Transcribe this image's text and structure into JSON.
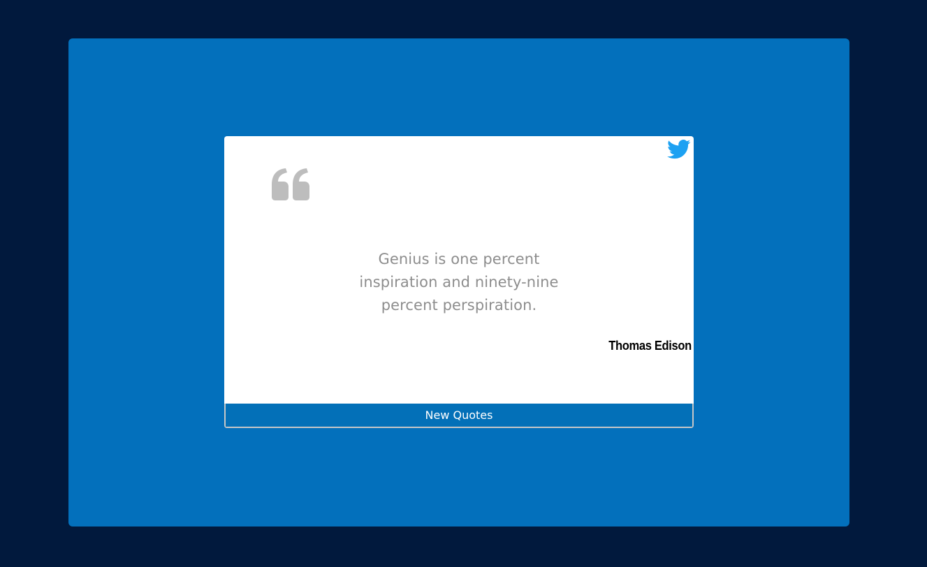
{
  "quote": {
    "text": "Genius is one percent inspiration and ninety-nine percent perspiration.",
    "author": "Thomas Edison"
  },
  "actions": {
    "new_quote_label": "New Quotes",
    "tweet_icon": "twitter-bird-icon"
  },
  "decor": {
    "quote_mark_icon": "quote-left-icon"
  },
  "colors": {
    "page_background": "#01193d",
    "stage_background": "#0370bc",
    "card_background": "#ffffff",
    "quote_text": "#8d8d8d",
    "quote_mark": "#bdbdbd",
    "author_text": "#000000",
    "button_background": "#0370b8",
    "twitter_blue": "#1da1f2"
  }
}
